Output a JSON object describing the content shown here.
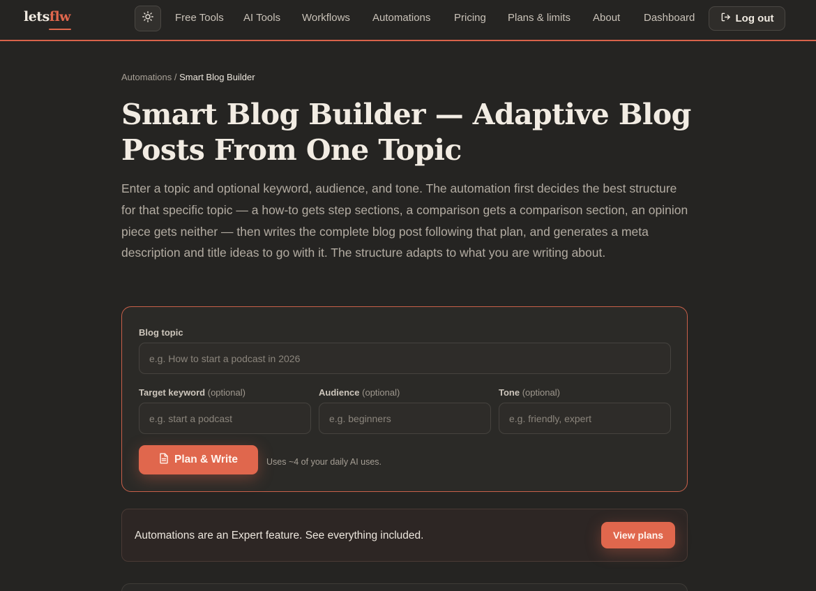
{
  "header": {
    "logo_primary": "lets",
    "logo_accent": "flw",
    "theme_toggle_icon": "sun-icon",
    "nav": [
      "Free Tools",
      "AI Tools",
      "Workflows",
      "Automations",
      "Pricing",
      "Plans & limits",
      "About",
      "Dashboard"
    ],
    "logout_label": "Log out",
    "logout_icon": "logout-icon"
  },
  "breadcrumb": {
    "parent": "Automations",
    "separator": "/",
    "current": "Smart Blog Builder"
  },
  "page": {
    "title": "Smart Blog Builder — Adaptive Blog Posts From One Topic",
    "description": "Enter a topic and optional keyword, audience, and tone. The automation first decides the best structure for that specific topic — a how-to gets step sections, a comparison gets a comparison section, an opinion piece gets neither — then writes the complete blog post following that plan, and generates a meta description and title ideas to go with it. The structure adapts to what you are writing about."
  },
  "form": {
    "topic_label": "Blog topic",
    "topic_placeholder": "e.g. How to start a podcast in 2026",
    "keyword_label": "Target keyword",
    "keyword_placeholder": "e.g. start a podcast",
    "audience_label": "Audience",
    "audience_placeholder": "e.g. beginners",
    "tone_label": "Tone",
    "tone_placeholder": "e.g. friendly, expert",
    "optional_text": "(optional)",
    "submit_label": "Plan & Write",
    "submit_icon": "document-icon",
    "usage_note": "Uses ~4 of your daily AI uses."
  },
  "banner": {
    "text": "Automations are an Expert feature. See everything included.",
    "button_label": "View plans"
  },
  "colors": {
    "accent": "#e0674d",
    "background": "#252422",
    "card": "#2b2a27",
    "text": "#e9e3da"
  }
}
